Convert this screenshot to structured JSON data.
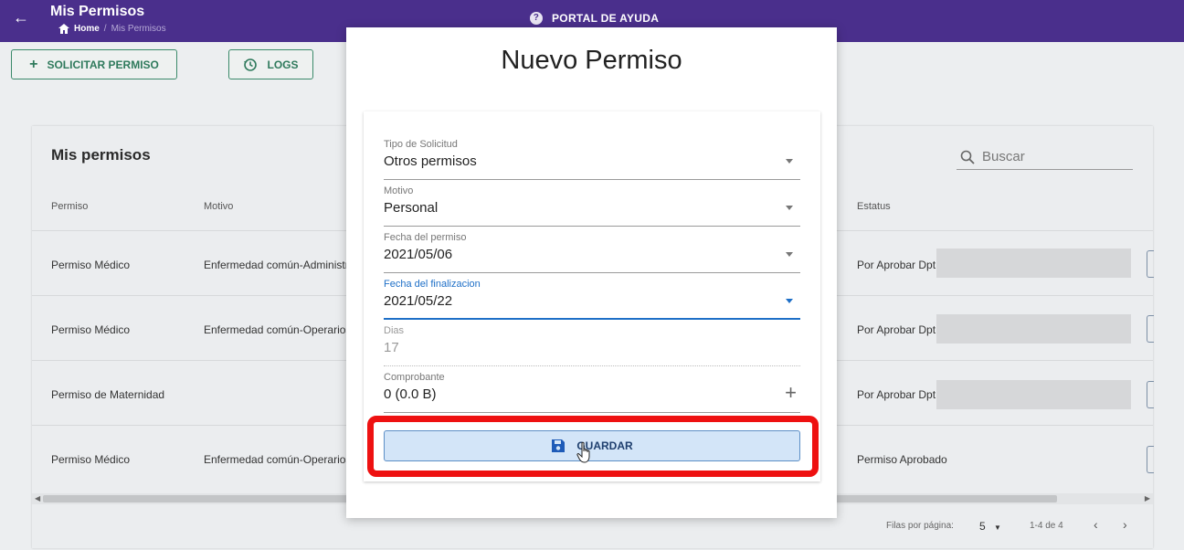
{
  "header": {
    "title": "Mis Permisos",
    "breadcrumb_home": "Home",
    "breadcrumb_sep": "/",
    "breadcrumb_current": "Mis Permisos",
    "help_label": "PORTAL DE AYUDA",
    "back_icon": "arrow-left-icon",
    "help_icon": "question-circle-icon"
  },
  "toolbar": {
    "solicitar_label": "SOLICITAR PERMISO",
    "logs_label": "LOGS"
  },
  "card": {
    "title": "Mis permisos",
    "search_placeholder": "Buscar",
    "columns": [
      "Permiso",
      "Motivo",
      "Estatus"
    ],
    "rows": [
      {
        "permiso": "Permiso Médico",
        "motivo": "Enfermedad común-Administr",
        "estatus": "Por Aprobar Dpt"
      },
      {
        "permiso": "Permiso Médico",
        "motivo": "Enfermedad común-Operarios",
        "estatus": "Por Aprobar Dpt"
      },
      {
        "permiso": "Permiso de Maternidad",
        "motivo": "",
        "estatus": "Por Aprobar Dpt"
      },
      {
        "permiso": "Permiso Médico",
        "motivo": "Enfermedad común-Operarios",
        "estatus": "Permiso Aprobado"
      }
    ],
    "pager": {
      "rows_per_page_label": "Filas por página:",
      "rows_per_page": "5",
      "range": "1-4 de 4"
    }
  },
  "modal": {
    "title": "Nuevo Permiso",
    "fields": {
      "tipo": {
        "label": "Tipo de Solicitud",
        "value": "Otros permisos"
      },
      "motivo": {
        "label": "Motivo",
        "value": "Personal"
      },
      "fecha_permiso": {
        "label": "Fecha del permiso",
        "value": "2021/05/06"
      },
      "fecha_fin": {
        "label": "Fecha del finalizacion",
        "value": "2021/05/22"
      },
      "dias": {
        "label": "Dias",
        "value": "17"
      },
      "comprobante": {
        "label": "Comprobante",
        "value": "0 (0.0 B)"
      }
    },
    "save_label": "GUARDAR"
  },
  "colors": {
    "header_bg": "#4a2f8c",
    "accent_green": "#2f7a5c",
    "focus_blue": "#1e6fc7",
    "highlight_red": "#ee1111",
    "save_bg": "#d3e5f8"
  }
}
